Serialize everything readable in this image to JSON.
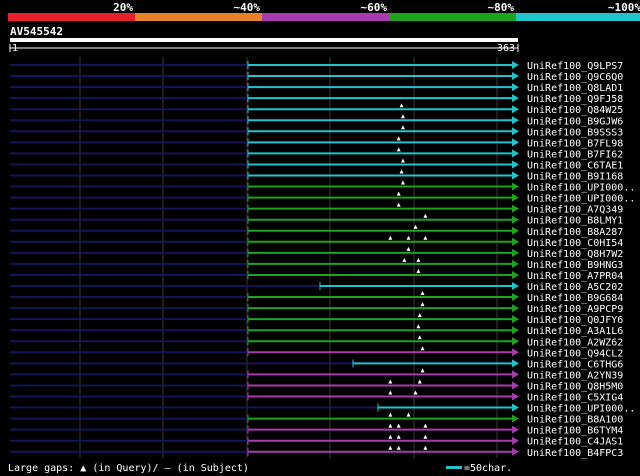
{
  "legend": {
    "ticks": [
      {
        "label": "20%",
        "color": "#e8202a"
      },
      {
        "label": "~40%",
        "color": "#e8822a"
      },
      {
        "label": "~60%",
        "color": "#a83ab0"
      },
      {
        "label": "~80%",
        "color": "#1ea31e"
      },
      {
        "label": "~100%",
        "color": "#1fc4cc"
      }
    ]
  },
  "query": {
    "name": "AV545542",
    "start": "1",
    "end": "363"
  },
  "footer": {
    "gaps_label": "Large gaps:",
    "query_marker": "▲",
    "query_text": "(in Query)/",
    "subject_marker": "—",
    "subject_text": " (in Subject)",
    "scale_text": "=50char."
  },
  "colors": {
    "background": "#000000",
    "axis_line": "#ffffff",
    "grid": "#3a3a3a",
    "query_track": "#15155a",
    "id_80": "#1ea31e",
    "id_100": "#1fc4cc",
    "id_60": "#a83ab0",
    "gap_marker": "#ffffff"
  },
  "chart_data": {
    "type": "alignment",
    "query_length": 363,
    "hits": [
      {
        "label": "UniRef100_Q9LPS7",
        "start": 1,
        "end": 363,
        "identity": "100",
        "gaps": []
      },
      {
        "label": "UniRef100_Q9C6Q0",
        "start": 1,
        "end": 363,
        "identity": "100",
        "gaps": []
      },
      {
        "label": "UniRef100_Q8LAD1",
        "start": 1,
        "end": 363,
        "identity": "100",
        "gaps": []
      },
      {
        "label": "UniRef100_Q9FJ58",
        "start": 1,
        "end": 363,
        "identity": "100",
        "gaps": []
      },
      {
        "label": "UniRef100_Q84W25",
        "start": 1,
        "end": 363,
        "identity": "100",
        "gaps": [
          280
        ]
      },
      {
        "label": "UniRef100_B9GJW6",
        "start": 1,
        "end": 363,
        "identity": "100",
        "gaps": [
          281
        ]
      },
      {
        "label": "UniRef100_B9SSS3",
        "start": 1,
        "end": 363,
        "identity": "100",
        "gaps": [
          281
        ]
      },
      {
        "label": "UniRef100_B7FL98",
        "start": 1,
        "end": 363,
        "identity": "100",
        "gaps": [
          278
        ]
      },
      {
        "label": "UniRef100_B7FI62",
        "start": 1,
        "end": 363,
        "identity": "100",
        "gaps": [
          278
        ]
      },
      {
        "label": "UniRef100_C6TAE1",
        "start": 1,
        "end": 363,
        "identity": "100",
        "gaps": [
          281
        ]
      },
      {
        "label": "UniRef100_B9I168",
        "start": 1,
        "end": 363,
        "identity": "100",
        "gaps": [
          280
        ]
      },
      {
        "label": "UniRef100_UPI000..",
        "start": 1,
        "end": 363,
        "identity": "80",
        "gaps": [
          281
        ]
      },
      {
        "label": "UniRef100_UPI000..",
        "start": 1,
        "end": 363,
        "identity": "80",
        "gaps": [
          278
        ]
      },
      {
        "label": "UniRef100_A7Q349",
        "start": 1,
        "end": 363,
        "identity": "80",
        "gaps": [
          278
        ]
      },
      {
        "label": "UniRef100_B8LMY1",
        "start": 1,
        "end": 363,
        "identity": "80",
        "gaps": [
          297
        ]
      },
      {
        "label": "UniRef100_B8A287",
        "start": 1,
        "end": 363,
        "identity": "80",
        "gaps": [
          290
        ]
      },
      {
        "label": "UniRef100_C0HI54",
        "start": 1,
        "end": 363,
        "identity": "80",
        "gaps": [
          272,
          285,
          297
        ]
      },
      {
        "label": "UniRef100_Q8H7W2",
        "start": 1,
        "end": 363,
        "identity": "80",
        "gaps": [
          285
        ]
      },
      {
        "label": "UniRef100_B9HNG3",
        "start": 1,
        "end": 363,
        "identity": "80",
        "gaps": [
          282,
          292
        ]
      },
      {
        "label": "UniRef100_A7PR04",
        "start": 1,
        "end": 363,
        "identity": "80",
        "gaps": [
          292
        ]
      },
      {
        "label": "UniRef100_A5C202",
        "start": 1,
        "end": 363,
        "identity": "100",
        "gaps": []
      },
      {
        "label": "UniRef100_B9G684",
        "start": 1,
        "end": 363,
        "identity": "80",
        "gaps": [
          295
        ]
      },
      {
        "label": "UniRef100_A9PCP9",
        "start": 1,
        "end": 363,
        "identity": "80",
        "gaps": [
          295
        ]
      },
      {
        "label": "UniRef100_Q0JFY6",
        "start": 1,
        "end": 363,
        "identity": "80",
        "gaps": [
          293
        ]
      },
      {
        "label": "UniRef100_A3A1L6",
        "start": 1,
        "end": 363,
        "identity": "80",
        "gaps": [
          292
        ]
      },
      {
        "label": "UniRef100_A2WZ62",
        "start": 1,
        "end": 363,
        "identity": "80",
        "gaps": [
          293
        ]
      },
      {
        "label": "UniRef100_Q94CL2",
        "start": 1,
        "end": 363,
        "identity": "60",
        "gaps": [
          295
        ]
      },
      {
        "label": "UniRef100_C6THG6",
        "start": 1,
        "end": 363,
        "identity": "100",
        "gaps": []
      },
      {
        "label": "UniRef100_A2YN39",
        "start": 1,
        "end": 363,
        "identity": "60",
        "gaps": [
          295
        ]
      },
      {
        "label": "UniRef100_Q8H5M0",
        "start": 1,
        "end": 363,
        "identity": "60",
        "gaps": [
          272,
          293
        ]
      },
      {
        "label": "UniRef100_C5XIG4",
        "start": 1,
        "end": 363,
        "identity": "60",
        "gaps": [
          272,
          290
        ]
      },
      {
        "label": "UniRef100_UPI000..",
        "start": 1,
        "end": 363,
        "identity": "100",
        "gaps": []
      },
      {
        "label": "UniRef100_B8A100",
        "start": 1,
        "end": 363,
        "identity": "80",
        "gaps": [
          272,
          285
        ]
      },
      {
        "label": "UniRef100_B6TYM4",
        "start": 1,
        "end": 363,
        "identity": "60",
        "gaps": [
          272,
          278,
          297
        ]
      },
      {
        "label": "UniRef100_C4JAS1",
        "start": 1,
        "end": 363,
        "identity": "60",
        "gaps": [
          272,
          278,
          297
        ]
      },
      {
        "label": "UniRef100_B4FPC3",
        "start": 1,
        "end": 363,
        "identity": "60",
        "gaps": [
          272,
          278,
          297
        ]
      }
    ]
  }
}
